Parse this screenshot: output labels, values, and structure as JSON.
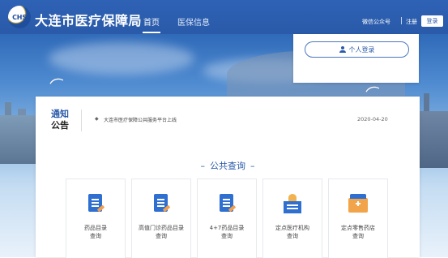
{
  "header": {
    "logo_text": "CHS",
    "site_title": "大连市医疗保障局",
    "nav": [
      {
        "label": "首页"
      },
      {
        "label": "医保信息"
      }
    ],
    "wechat_label": "微信公众号",
    "register_label": "注册",
    "login_label": "登录"
  },
  "login_panel": {
    "personal_login_label": "个人登录"
  },
  "notice": {
    "title_line1": "通知",
    "title_line2": "公告",
    "items": [
      {
        "text": "大连市医疗保障公共服务平台上线",
        "date": "2020-04-20"
      }
    ]
  },
  "public_query": {
    "title": "公共查询",
    "tiles": [
      {
        "label_line1": "药品目录",
        "label_line2": "查询",
        "icon": "document-icon"
      },
      {
        "label_line1": "高值门诊药品目录",
        "label_line2": "查询",
        "icon": "document-icon"
      },
      {
        "label_line1": "4+7药品目录",
        "label_line2": "查询",
        "icon": "document-icon"
      },
      {
        "label_line1": "定点医疗机构",
        "label_line2": "查询",
        "icon": "hospital-icon"
      },
      {
        "label_line1": "定点零售药店",
        "label_line2": "查询",
        "icon": "pharmacy-icon"
      }
    ]
  },
  "colors": {
    "brand_blue": "#2a5aa9",
    "icon_blue": "#2f6fd0",
    "icon_orange": "#f2a44a"
  }
}
